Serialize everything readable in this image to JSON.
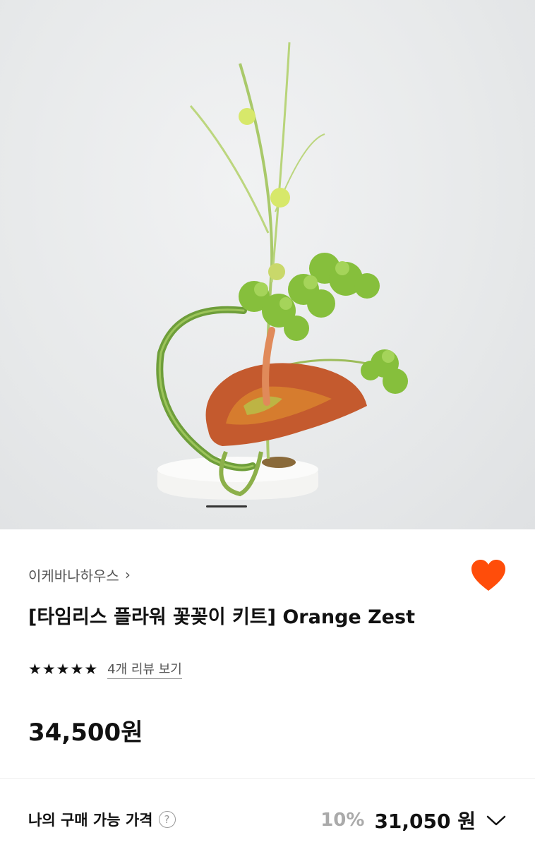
{
  "product": {
    "brand": "이케바나하우스",
    "title": "[타임리스 플라워 꽃꽂이 키트] Orange Zest",
    "rating_stars": 5,
    "review_link": "4개 리뷰 보기",
    "price": "34,500원",
    "image_alt": "ikebana flower arrangement with anthurium"
  },
  "purchase": {
    "label": "나의 구매 가능 가격",
    "help_symbol": "?",
    "discount": "10%",
    "sale_price": "31,050 원"
  },
  "colors": {
    "heart": "#ff4d0a",
    "text": "#111111",
    "muted": "#555555",
    "discount": "#aaaaaa"
  },
  "icons": {
    "brand_chevron": "chevron-right-icon",
    "wishlist": "heart-icon",
    "expand": "chevron-down-icon",
    "help": "question-circle-icon",
    "star": "star-icon"
  }
}
